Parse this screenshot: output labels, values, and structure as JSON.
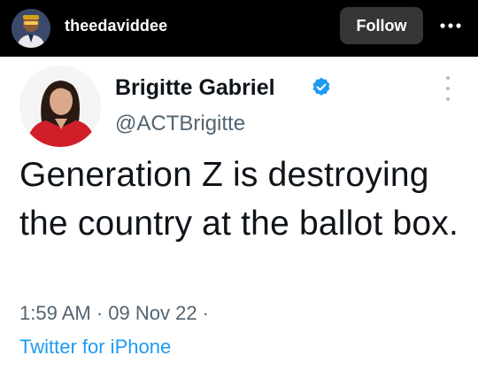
{
  "ig_header": {
    "username": "theedaviddee",
    "follow_label": "Follow",
    "more_icon": "more-horizontal-icon"
  },
  "tweet": {
    "author_name": "Brigitte Gabriel",
    "handle": "@ACTBrigitte",
    "verified_icon": "verified-badge-icon",
    "text": "Generation Z is destroying the country at the ballot box.",
    "time": "1:59 AM",
    "date": "09 Nov 22",
    "meta_line": "1:59 AM · 09 Nov 22 ·",
    "source": "Twitter for iPhone"
  },
  "colors": {
    "header_bg": "#000000",
    "follow_bg": "#363636",
    "verified_blue": "#1d9bf0",
    "link_blue": "#1d9bf0",
    "muted_gray": "#536471"
  }
}
